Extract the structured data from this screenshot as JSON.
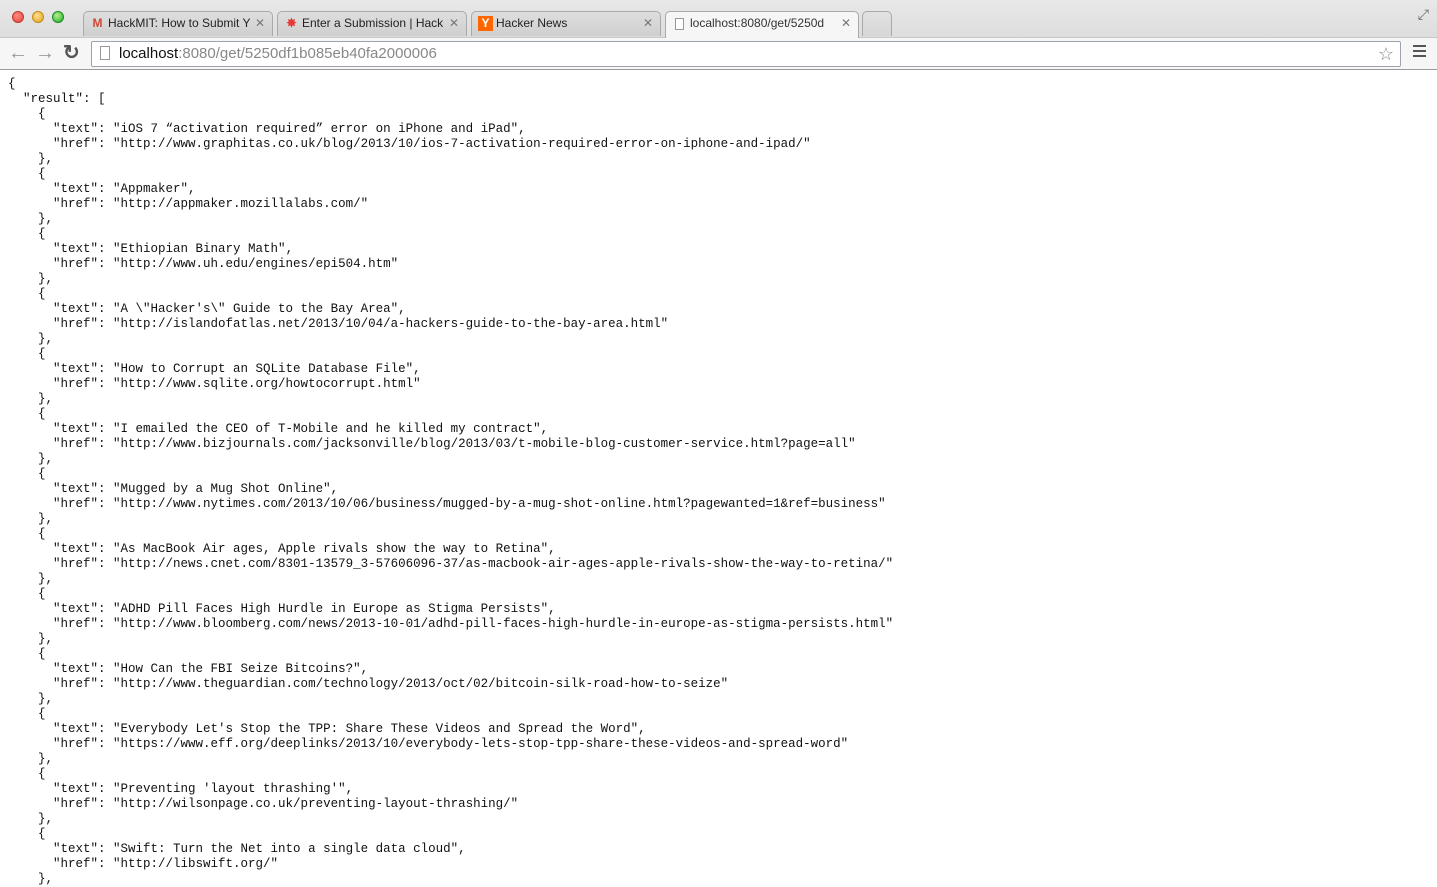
{
  "window": {
    "tabs": [
      {
        "title": "HackMIT: How to Submit Y",
        "favicon": "gmail-icon",
        "favicon_glyph": "M",
        "favicon_color": "#d14836",
        "active": false
      },
      {
        "title": "Enter a Submission | Hack",
        "favicon": "pinwheel-icon",
        "favicon_glyph": "✸",
        "favicon_color": "#e53935",
        "active": false
      },
      {
        "title": "Hacker News",
        "favicon": "y-combinator-icon",
        "favicon_glyph": "Y",
        "favicon_color": "#ff6600",
        "active": false
      },
      {
        "title": "localhost:8080/get/5250d",
        "favicon": "page-icon",
        "favicon_glyph": "",
        "favicon_color": "#999999",
        "active": true
      }
    ]
  },
  "toolbar": {
    "back_glyph": "←",
    "forward_glyph": "→",
    "reload_glyph": "↻",
    "url_host": "localhost",
    "url_rest": ":8080/get/5250df1b085eb40fa2000006",
    "bookmark_star_glyph": "☆"
  },
  "json_view": {
    "open_brace": "{",
    "result_open": "  \"result\": [",
    "items": [
      {
        "text": "iOS 7 “activation required” error on iPhone and iPad",
        "href": "http://www.graphitas.co.uk/blog/2013/10/ios-7-activation-required-error-on-iphone-and-ipad/"
      },
      {
        "text": "Appmaker",
        "href": "http://appmaker.mozillalabs.com/"
      },
      {
        "text": "Ethiopian Binary Math",
        "href": "http://www.uh.edu/engines/epi504.htm"
      },
      {
        "text": "A \\\"Hacker's\\\" Guide to the Bay Area",
        "href": "http://islandofatlas.net/2013/10/04/a-hackers-guide-to-the-bay-area.html"
      },
      {
        "text": "How to Corrupt an SQLite Database File",
        "href": "http://www.sqlite.org/howtocorrupt.html"
      },
      {
        "text": "I emailed the CEO of T-Mobile and he killed my contract",
        "href": "http://www.bizjournals.com/jacksonville/blog/2013/03/t-mobile-blog-customer-service.html?page=all"
      },
      {
        "text": "Mugged by a Mug Shot Online",
        "href": "http://www.nytimes.com/2013/10/06/business/mugged-by-a-mug-shot-online.html?pagewanted=1&ref=business"
      },
      {
        "text": "As MacBook Air ages, Apple rivals show the way to Retina",
        "href": "http://news.cnet.com/8301-13579_3-57606096-37/as-macbook-air-ages-apple-rivals-show-the-way-to-retina/"
      },
      {
        "text": "ADHD Pill Faces High Hurdle in Europe as Stigma Persists",
        "href": "http://www.bloomberg.com/news/2013-10-01/adhd-pill-faces-high-hurdle-in-europe-as-stigma-persists.html"
      },
      {
        "text": "How Can the FBI Seize Bitcoins?",
        "href": "http://www.theguardian.com/technology/2013/oct/02/bitcoin-silk-road-how-to-seize"
      },
      {
        "text": "Everybody Let's Stop the TPP: Share These Videos and Spread the Word",
        "href": "https://www.eff.org/deeplinks/2013/10/everybody-lets-stop-tpp-share-these-videos-and-spread-word"
      },
      {
        "text": "Preventing 'layout thrashing'",
        "href": "http://wilsonpage.co.uk/preventing-layout-thrashing/"
      },
      {
        "text": "Swift: Turn the Net into a single data cloud",
        "href": "http://libswift.org/"
      }
    ]
  }
}
